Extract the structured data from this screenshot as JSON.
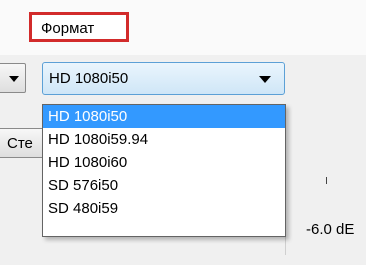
{
  "section": {
    "title": "Формат"
  },
  "left_button": {
    "label": "Сте"
  },
  "format_combobox": {
    "selected": "HD 1080i50",
    "options": [
      "HD 1080i50",
      "HD 1080i59.94",
      "HD 1080i60",
      "SD 576i50",
      "SD 480i59"
    ],
    "selected_index": 0
  },
  "slider": {
    "value_text": "-6.0 dE"
  },
  "colors": {
    "highlight": "#3399ff",
    "label_border": "#d22b2b",
    "combobox_border": "#5ca0d6"
  },
  "icons": {
    "combobox_arrow": "chevron-down-icon",
    "left_dropdown_arrow": "chevron-down-icon"
  }
}
